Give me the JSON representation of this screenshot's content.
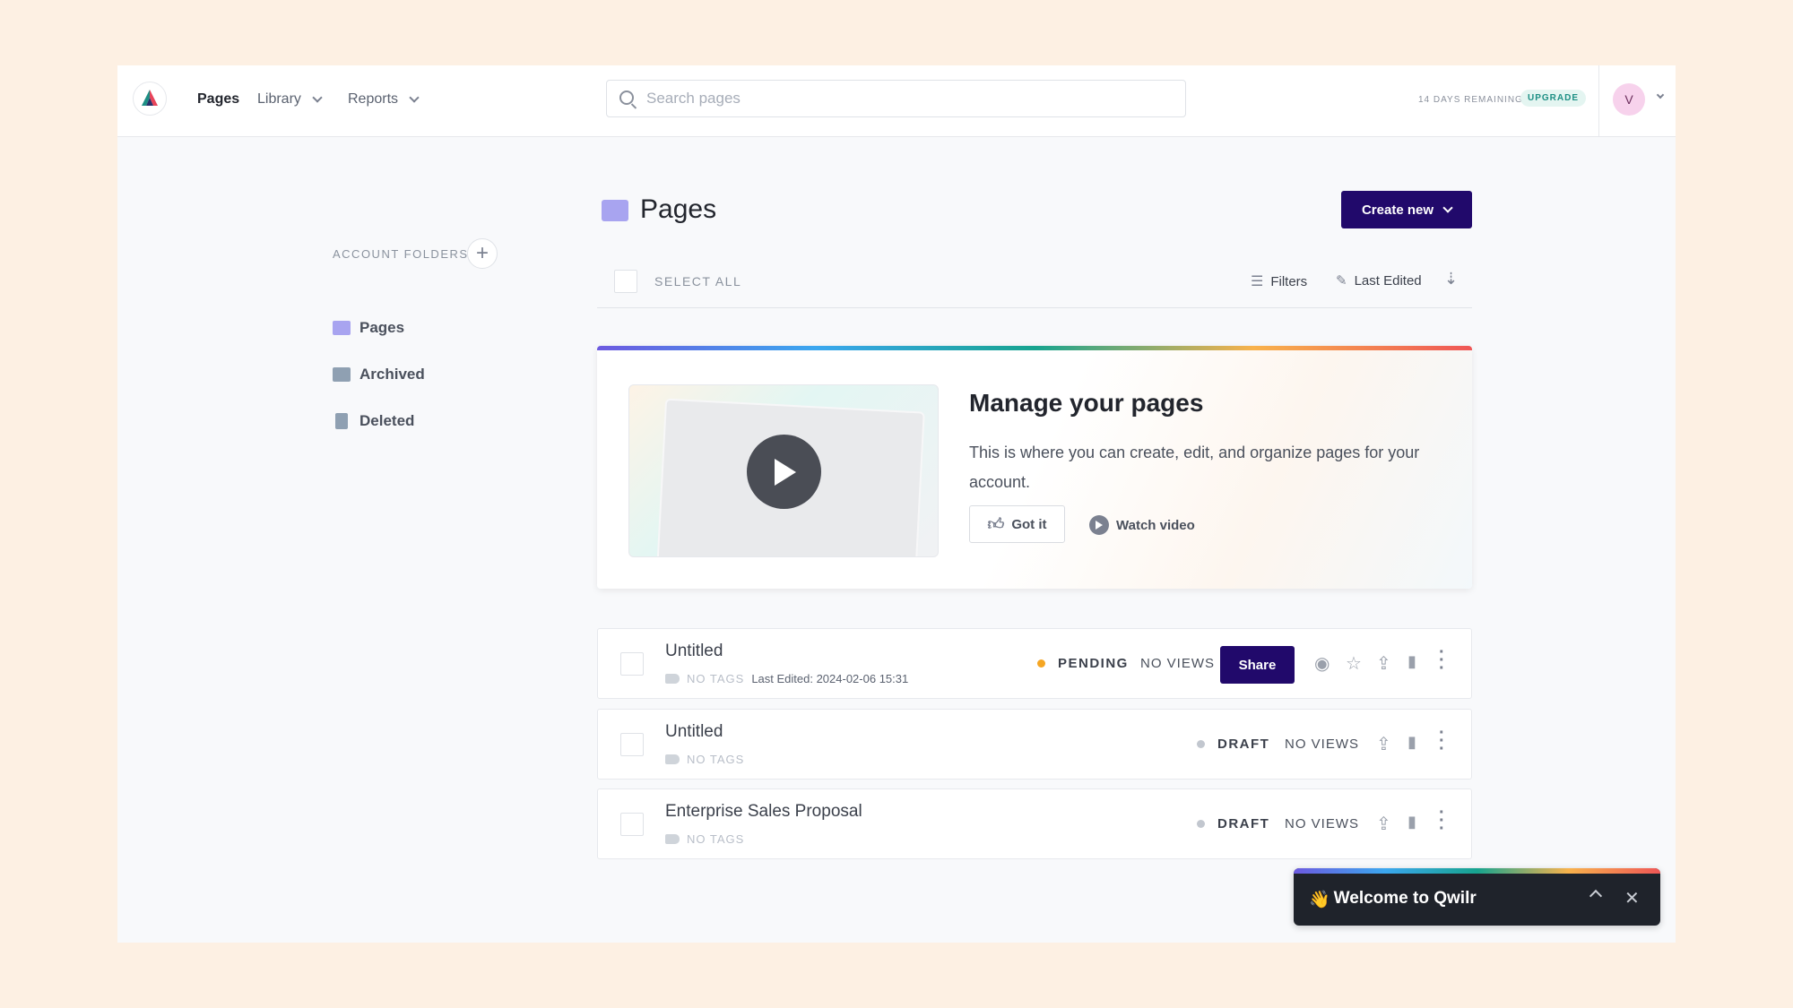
{
  "nav": {
    "pages": "Pages",
    "library": "Library",
    "reports": "Reports"
  },
  "search": {
    "placeholder": "Search pages"
  },
  "trial": {
    "remaining": "14 DAYS REMAINING",
    "upgrade": "UPGRADE"
  },
  "user": {
    "initial": "V"
  },
  "page": {
    "title": "Pages",
    "create_new": "Create new",
    "select_all": "SELECT ALL",
    "filters": "Filters",
    "sort": "Last Edited"
  },
  "sidebar": {
    "heading": "ACCOUNT FOLDERS",
    "items": [
      {
        "label": "Pages",
        "icon": "folder-icon"
      },
      {
        "label": "Archived",
        "icon": "archive-icon"
      },
      {
        "label": "Deleted",
        "icon": "trash-icon"
      }
    ]
  },
  "onboarding": {
    "title": "Manage your pages",
    "body": "This is where you can create, edit, and organize pages for your account.",
    "got_it": "Got it",
    "watch_video": "Watch video"
  },
  "rows": [
    {
      "title": "Untitled",
      "tags": "NO TAGS",
      "last_edited": "Last Edited: 2024-02-06 15:31",
      "status": "PENDING",
      "status_color": "#f5a623",
      "views": "NO VIEWS",
      "share": "Share"
    },
    {
      "title": "Untitled",
      "tags": "NO TAGS",
      "status": "DRAFT",
      "status_color": "#c2c7cf",
      "views": "NO VIEWS"
    },
    {
      "title": "Enterprise Sales Proposal",
      "tags": "NO TAGS",
      "status": "DRAFT",
      "status_color": "#c2c7cf",
      "views": "NO VIEWS"
    }
  ],
  "toast": {
    "emoji": "👋",
    "text": "Welcome to Qwilr"
  },
  "colors": {
    "brand": "#21096b",
    "background": "#fdf0e3"
  }
}
